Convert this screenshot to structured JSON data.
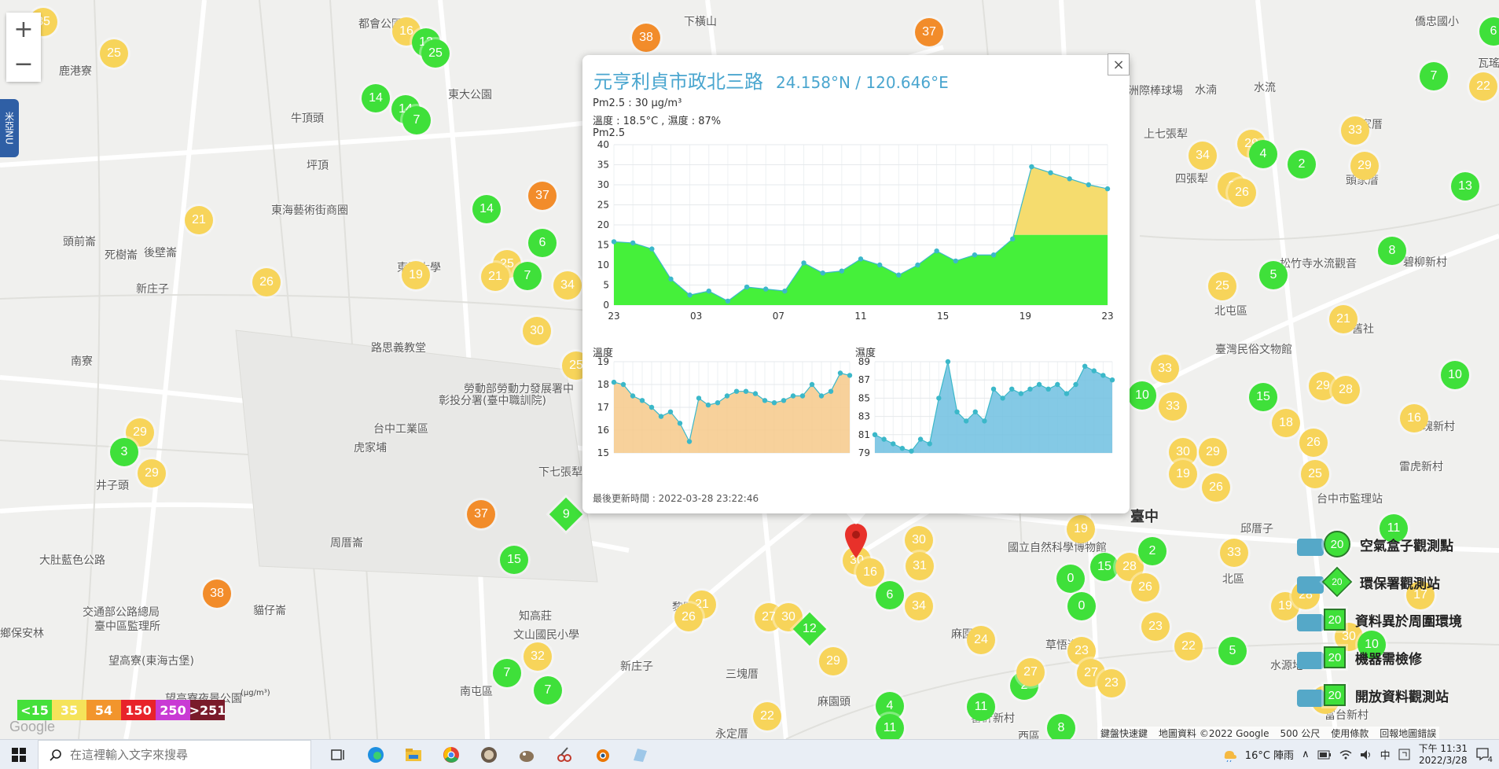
{
  "map": {
    "zoom_in": "+",
    "zoom_out": "−",
    "side_tab": "米亞NU",
    "places": [
      {
        "t": "鹿港寮",
        "x": 75,
        "y": 80
      },
      {
        "t": "都會公園",
        "x": 456,
        "y": 20
      },
      {
        "t": "下橫山",
        "x": 870,
        "y": 17
      },
      {
        "t": "東大公園",
        "x": 570,
        "y": 110
      },
      {
        "t": "牛頂頭",
        "x": 370,
        "y": 140
      },
      {
        "t": "坪頂",
        "x": 390,
        "y": 200
      },
      {
        "t": "東海藝術街商圈",
        "x": 345,
        "y": 257
      },
      {
        "t": "頭前崙",
        "x": 80,
        "y": 297
      },
      {
        "t": "死樹崙",
        "x": 133,
        "y": 314
      },
      {
        "t": "後壁崙",
        "x": 183,
        "y": 311
      },
      {
        "t": "新庄子",
        "x": 173,
        "y": 357
      },
      {
        "t": "東海大學",
        "x": 505,
        "y": 330
      },
      {
        "t": "路思義教堂",
        "x": 472,
        "y": 432
      },
      {
        "t": "南寮",
        "x": 90,
        "y": 449
      },
      {
        "t": "勞動部勞動力發展署中",
        "x": 590,
        "y": 484
      },
      {
        "t": "彰投分署(臺中職訓院)",
        "x": 558,
        "y": 499
      },
      {
        "t": "台中工業區",
        "x": 475,
        "y": 535
      },
      {
        "t": "虎家埔",
        "x": 450,
        "y": 559
      },
      {
        "t": "下七張犁",
        "x": 685,
        "y": 590
      },
      {
        "t": "井子頭",
        "x": 122,
        "y": 607
      },
      {
        "t": "周厝崙",
        "x": 420,
        "y": 680
      },
      {
        "t": "大肚藍色公路",
        "x": 50,
        "y": 702
      },
      {
        "t": "交通部公路總局",
        "x": 105,
        "y": 768
      },
      {
        "t": "臺中區監理所",
        "x": 120,
        "y": 786
      },
      {
        "t": "鄉保安林",
        "x": 0,
        "y": 795
      },
      {
        "t": "貓仔崙",
        "x": 322,
        "y": 766
      },
      {
        "t": "望高寮(東海古堡)",
        "x": 138,
        "y": 830
      },
      {
        "t": "望高寮夜景公園",
        "x": 210,
        "y": 878
      },
      {
        "t": "南屯區",
        "x": 585,
        "y": 869
      },
      {
        "t": "知高莊",
        "x": 660,
        "y": 773
      },
      {
        "t": "文山國民小學",
        "x": 653,
        "y": 797
      },
      {
        "t": "新庄子",
        "x": 789,
        "y": 837
      },
      {
        "t": "三塊厝",
        "x": 923,
        "y": 847
      },
      {
        "t": "黎明新村",
        "x": 855,
        "y": 762
      },
      {
        "t": "永定厝",
        "x": 910,
        "y": 923
      },
      {
        "t": "麻園頭",
        "x": 1040,
        "y": 882
      },
      {
        "t": "麻園頭",
        "x": 1210,
        "y": 796
      },
      {
        "t": "審計新村",
        "x": 1235,
        "y": 903
      },
      {
        "t": "西區",
        "x": 1295,
        "y": 926
      },
      {
        "t": "草悟道",
        "x": 1330,
        "y": 810
      },
      {
        "t": "國立自然科學博物館",
        "x": 1282,
        "y": 686
      },
      {
        "t": "北區",
        "x": 1555,
        "y": 726
      },
      {
        "t": "水源地",
        "x": 1616,
        "y": 836
      },
      {
        "t": "富台新村",
        "x": 1685,
        "y": 899
      },
      {
        "t": "邱厝子",
        "x": 1578,
        "y": 662
      },
      {
        "t": "台中市監理站",
        "x": 1675,
        "y": 624
      },
      {
        "t": "雷虎新村",
        "x": 1780,
        "y": 583
      },
      {
        "t": "玫瑰新村",
        "x": 1795,
        "y": 532
      },
      {
        "t": "舊社",
        "x": 1720,
        "y": 408
      },
      {
        "t": "北屯區",
        "x": 1545,
        "y": 385
      },
      {
        "t": "臺灣民俗文物館",
        "x": 1546,
        "y": 434
      },
      {
        "t": "松竹寺水流觀音",
        "x": 1628,
        "y": 325
      },
      {
        "t": "碧柳新村",
        "x": 1785,
        "y": 323
      },
      {
        "t": "頭家厝",
        "x": 1712,
        "y": 219
      },
      {
        "t": "頭家厝",
        "x": 1717,
        "y": 148
      },
      {
        "t": "四張犁",
        "x": 1495,
        "y": 217
      },
      {
        "t": "上七張犁",
        "x": 1455,
        "y": 160
      },
      {
        "t": "洲際棒球場",
        "x": 1435,
        "y": 105
      },
      {
        "t": "水湳",
        "x": 1520,
        "y": 104
      },
      {
        "t": "水流",
        "x": 1595,
        "y": 101
      },
      {
        "t": "僑忠國小",
        "x": 1800,
        "y": 17
      },
      {
        "t": "瓦瑤",
        "x": 1880,
        "y": 70
      },
      {
        "t": "臺中",
        "x": 1438,
        "y": 643,
        "big": true
      }
    ],
    "markers": [
      {
        "v": "35",
        "c": "y",
        "x": 55,
        "y": 28
      },
      {
        "v": "25",
        "c": "y",
        "x": 145,
        "y": 68
      },
      {
        "v": "16",
        "c": "y",
        "x": 517,
        "y": 40
      },
      {
        "v": "13",
        "c": "g",
        "x": 542,
        "y": 54
      },
      {
        "v": "25",
        "c": "g",
        "x": 554,
        "y": 68
      },
      {
        "v": "38",
        "c": "o",
        "x": 822,
        "y": 48
      },
      {
        "v": "37",
        "c": "o",
        "x": 1182,
        "y": 41
      },
      {
        "v": "14",
        "c": "g",
        "x": 478,
        "y": 125
      },
      {
        "v": "14",
        "c": "g",
        "x": 516,
        "y": 139
      },
      {
        "v": "7",
        "c": "g",
        "x": 530,
        "y": 153
      },
      {
        "v": "14",
        "c": "g",
        "x": 619,
        "y": 266
      },
      {
        "v": "37",
        "c": "o",
        "x": 690,
        "y": 249
      },
      {
        "v": "21",
        "c": "y",
        "x": 253,
        "y": 280
      },
      {
        "v": "6",
        "c": "g",
        "x": 690,
        "y": 309
      },
      {
        "v": "25",
        "c": "y",
        "x": 645,
        "y": 336
      },
      {
        "v": "21",
        "c": "y",
        "x": 630,
        "y": 352
      },
      {
        "v": "7",
        "c": "g",
        "x": 671,
        "y": 351
      },
      {
        "v": "34",
        "c": "y",
        "x": 722,
        "y": 363
      },
      {
        "v": "26",
        "c": "y",
        "x": 339,
        "y": 359
      },
      {
        "v": "19",
        "c": "y",
        "x": 529,
        "y": 350
      },
      {
        "v": "30",
        "c": "y",
        "x": 683,
        "y": 421
      },
      {
        "v": "25",
        "c": "y",
        "x": 733,
        "y": 465
      },
      {
        "v": "29",
        "c": "y",
        "x": 178,
        "y": 550
      },
      {
        "v": "3",
        "c": "g",
        "x": 158,
        "y": 575
      },
      {
        "v": "29",
        "c": "y",
        "x": 193,
        "y": 602
      },
      {
        "v": "37",
        "c": "o",
        "x": 612,
        "y": 654
      },
      {
        "v": "15",
        "c": "g",
        "x": 654,
        "y": 712
      },
      {
        "v": "38",
        "c": "o",
        "x": 276,
        "y": 755
      },
      {
        "v": "32",
        "c": "y",
        "x": 684,
        "y": 835
      },
      {
        "v": "7",
        "c": "g",
        "x": 645,
        "y": 856
      },
      {
        "v": "7",
        "c": "g",
        "x": 697,
        "y": 878
      },
      {
        "v": "21",
        "c": "y",
        "x": 893,
        "y": 769
      },
      {
        "v": "26",
        "c": "y",
        "x": 876,
        "y": 785
      },
      {
        "v": "27",
        "c": "y",
        "x": 978,
        "y": 785
      },
      {
        "v": "30",
        "c": "y",
        "x": 1003,
        "y": 785
      },
      {
        "v": "29",
        "c": "y",
        "x": 1060,
        "y": 841
      },
      {
        "v": "22",
        "c": "y",
        "x": 976,
        "y": 911
      },
      {
        "v": "30",
        "c": "y",
        "x": 1090,
        "y": 713
      },
      {
        "v": "16",
        "c": "y",
        "x": 1107,
        "y": 728
      },
      {
        "v": "30",
        "c": "y",
        "x": 1169,
        "y": 687
      },
      {
        "v": "31",
        "c": "y",
        "x": 1170,
        "y": 720
      },
      {
        "v": "6",
        "c": "g",
        "x": 1132,
        "y": 757
      },
      {
        "v": "34",
        "c": "y",
        "x": 1169,
        "y": 771
      },
      {
        "v": "24",
        "c": "y",
        "x": 1248,
        "y": 814
      },
      {
        "v": "4",
        "c": "g",
        "x": 1132,
        "y": 898
      },
      {
        "v": "11",
        "c": "g",
        "x": 1132,
        "y": 926
      },
      {
        "v": "11",
        "c": "g",
        "x": 1248,
        "y": 899
      },
      {
        "v": "2",
        "c": "g",
        "x": 1303,
        "y": 872
      },
      {
        "v": "27",
        "c": "y",
        "x": 1311,
        "y": 855
      },
      {
        "v": "8",
        "c": "g",
        "x": 1350,
        "y": 926
      },
      {
        "v": "23",
        "c": "y",
        "x": 1376,
        "y": 828
      },
      {
        "v": "27",
        "c": "y",
        "x": 1388,
        "y": 856
      },
      {
        "v": "23",
        "c": "y",
        "x": 1414,
        "y": 869
      },
      {
        "v": "19",
        "c": "y",
        "x": 1375,
        "y": 673
      },
      {
        "v": "0",
        "c": "g",
        "x": 1362,
        "y": 736
      },
      {
        "v": "0",
        "c": "g",
        "x": 1376,
        "y": 771
      },
      {
        "v": "15",
        "c": "g",
        "x": 1405,
        "y": 721
      },
      {
        "v": "28",
        "c": "y",
        "x": 1437,
        "y": 721
      },
      {
        "v": "26",
        "c": "y",
        "x": 1457,
        "y": 747
      },
      {
        "v": "2",
        "c": "g",
        "x": 1466,
        "y": 701
      },
      {
        "v": "23",
        "c": "y",
        "x": 1470,
        "y": 797
      },
      {
        "v": "22",
        "c": "y",
        "x": 1512,
        "y": 822
      },
      {
        "v": "33",
        "c": "y",
        "x": 1570,
        "y": 703
      },
      {
        "v": "5",
        "c": "g",
        "x": 1568,
        "y": 828
      },
      {
        "v": "10",
        "c": "g",
        "x": 1453,
        "y": 503
      },
      {
        "v": "33",
        "c": "y",
        "x": 1482,
        "y": 469
      },
      {
        "v": "33",
        "c": "y",
        "x": 1492,
        "y": 517
      },
      {
        "v": "15",
        "c": "g",
        "x": 1607,
        "y": 505
      },
      {
        "v": "18",
        "c": "y",
        "x": 1636,
        "y": 538
      },
      {
        "v": "30",
        "c": "y",
        "x": 1505,
        "y": 575
      },
      {
        "v": "19",
        "c": "y",
        "x": 1505,
        "y": 603
      },
      {
        "v": "29",
        "c": "y",
        "x": 1543,
        "y": 575
      },
      {
        "v": "26",
        "c": "y",
        "x": 1547,
        "y": 620
      },
      {
        "v": "26",
        "c": "y",
        "x": 1671,
        "y": 563
      },
      {
        "v": "25",
        "c": "y",
        "x": 1673,
        "y": 603
      },
      {
        "v": "29",
        "c": "y",
        "x": 1683,
        "y": 491
      },
      {
        "v": "28",
        "c": "y",
        "x": 1712,
        "y": 496
      },
      {
        "v": "16",
        "c": "y",
        "x": 1799,
        "y": 532
      },
      {
        "v": "10",
        "c": "g",
        "x": 1851,
        "y": 477
      },
      {
        "v": "11",
        "c": "g",
        "x": 1773,
        "y": 672
      },
      {
        "v": "17",
        "c": "y",
        "x": 1807,
        "y": 757
      },
      {
        "v": "19",
        "c": "y",
        "x": 1635,
        "y": 771
      },
      {
        "v": "28",
        "c": "y",
        "x": 1661,
        "y": 757
      },
      {
        "v": "30",
        "c": "y",
        "x": 1716,
        "y": 810
      },
      {
        "v": "10",
        "c": "g",
        "x": 1745,
        "y": 820
      },
      {
        "v": "28",
        "c": "y",
        "x": 1686,
        "y": 890
      },
      {
        "v": "34",
        "c": "y",
        "x": 1530,
        "y": 198
      },
      {
        "v": "29",
        "c": "y",
        "x": 1592,
        "y": 183
      },
      {
        "v": "4",
        "c": "g",
        "x": 1607,
        "y": 196
      },
      {
        "v": "3",
        "c": "y",
        "x": 1567,
        "y": 237
      },
      {
        "v": "26",
        "c": "y",
        "x": 1580,
        "y": 245
      },
      {
        "v": "2",
        "c": "g",
        "x": 1656,
        "y": 209
      },
      {
        "v": "33",
        "c": "y",
        "x": 1724,
        "y": 166
      },
      {
        "v": "29",
        "c": "y",
        "x": 1736,
        "y": 211
      },
      {
        "v": "7",
        "c": "g",
        "x": 1824,
        "y": 97
      },
      {
        "v": "22",
        "c": "y",
        "x": 1887,
        "y": 110
      },
      {
        "v": "13",
        "c": "g",
        "x": 1864,
        "y": 237
      },
      {
        "v": "8",
        "c": "g",
        "x": 1771,
        "y": 319
      },
      {
        "v": "5",
        "c": "g",
        "x": 1620,
        "y": 350
      },
      {
        "v": "25",
        "c": "y",
        "x": 1555,
        "y": 364
      },
      {
        "v": "21",
        "c": "y",
        "x": 1709,
        "y": 406
      },
      {
        "v": "6",
        "c": "g",
        "x": 1900,
        "y": 40
      }
    ],
    "diamonds": [
      {
        "v": "9",
        "c": "g",
        "x": 720,
        "y": 654
      },
      {
        "v": "12",
        "c": "g",
        "x": 1030,
        "y": 800
      }
    ],
    "scale_unit": "(μg/m³)",
    "scale": [
      {
        "label": "<15",
        "color": "#45e03a"
      },
      {
        "label": "35",
        "color": "#f5e35a"
      },
      {
        "label": "54",
        "color": "#f2952c"
      },
      {
        "label": "150",
        "color": "#e8232a"
      },
      {
        "label": "250",
        "color": "#c93bd4"
      },
      {
        "label": ">251",
        "color": "#7a1b2a"
      }
    ],
    "google": "Google",
    "attribution": [
      "鍵盤快速鍵",
      "地圖資料 ©2022 Google",
      "500 公尺",
      "使用條款",
      "回報地圖錯誤"
    ]
  },
  "legend": [
    {
      "label": "空氣盒子觀測點",
      "value": "20",
      "shape": "circle"
    },
    {
      "label": "環保署觀測站",
      "value": "20",
      "shape": "diamond"
    },
    {
      "label": "資料異於周圍環境",
      "value": "20",
      "shape": "house"
    },
    {
      "label": "機器需檢修",
      "value": "20",
      "shape": "triangle"
    },
    {
      "label": "開放資料觀測站",
      "value": "20",
      "shape": "square"
    }
  ],
  "popup": {
    "close": "×",
    "title": "元亨利貞市政北三路",
    "coord": "24.158°N / 120.646°E",
    "pm25_line": "Pm2.5 : 30 μg/m³",
    "temp_line": "溫度 : 18.5°C , 濕度 : 87%",
    "chart_label": "Pm2.5",
    "temp_label": "溫度",
    "hum_label": "濕度",
    "updated": "最後更新時間 : 2022-03-28 23:22:46"
  },
  "chart_data": [
    {
      "type": "area",
      "title": "Pm2.5",
      "xlabel": "",
      "ylabel": "",
      "x_ticks": [
        "23",
        "03",
        "07",
        "11",
        "15",
        "19",
        "23"
      ],
      "ylim": [
        0,
        40
      ],
      "y_ticks": [
        0,
        5,
        10,
        15,
        20,
        25,
        30,
        35,
        40
      ],
      "grid": true,
      "threshold": 17.5,
      "colors": {
        "low": "#45f03a",
        "high": "#f5dc6e",
        "point": "#3bb8c9"
      },
      "values": [
        15.8,
        15.5,
        14,
        6.5,
        2.5,
        3.5,
        1,
        4.5,
        4,
        3.5,
        10.5,
        8,
        8.5,
        11.5,
        10,
        7.5,
        10,
        13.5,
        11,
        12.5,
        12.5,
        16.5,
        34.5,
        33,
        31.5,
        30,
        29
      ]
    },
    {
      "type": "area",
      "title": "溫度",
      "x_ticks": [],
      "ylim": [
        15,
        19
      ],
      "y_ticks": [
        15,
        16,
        17,
        18,
        19
      ],
      "grid": true,
      "colors": {
        "fill": "#f6c98a",
        "point": "#3bb8c9"
      },
      "values": [
        18.1,
        18,
        17.5,
        17.3,
        17,
        16.6,
        16.8,
        16.3,
        15.5,
        17.4,
        17.1,
        17.2,
        17.5,
        17.7,
        17.7,
        17.6,
        17.3,
        17.2,
        17.3,
        17.5,
        17.5,
        18,
        17.5,
        17.7,
        18.5,
        18.4
      ]
    },
    {
      "type": "area",
      "title": "濕度",
      "x_ticks": [],
      "ylim": [
        79,
        89
      ],
      "y_ticks": [
        79,
        81,
        83,
        85,
        87,
        89
      ],
      "grid": true,
      "colors": {
        "fill": "#6fc0e0",
        "point": "#3bb8c9"
      },
      "values": [
        81,
        80.5,
        80,
        79.5,
        79.2,
        80.5,
        80,
        85,
        89,
        83.5,
        82.5,
        83.5,
        82.5,
        86,
        85,
        86,
        85.5,
        86,
        86.5,
        86,
        86.5,
        85.5,
        86.5,
        88.5,
        88,
        87.5,
        87
      ]
    }
  ],
  "taskbar": {
    "search_placeholder": "在這裡輸入文字來搜尋",
    "weather": "16°C 陣雨",
    "ime": "中",
    "time": "下午 11:31",
    "date": "2022/3/28",
    "notif_count": "4"
  }
}
